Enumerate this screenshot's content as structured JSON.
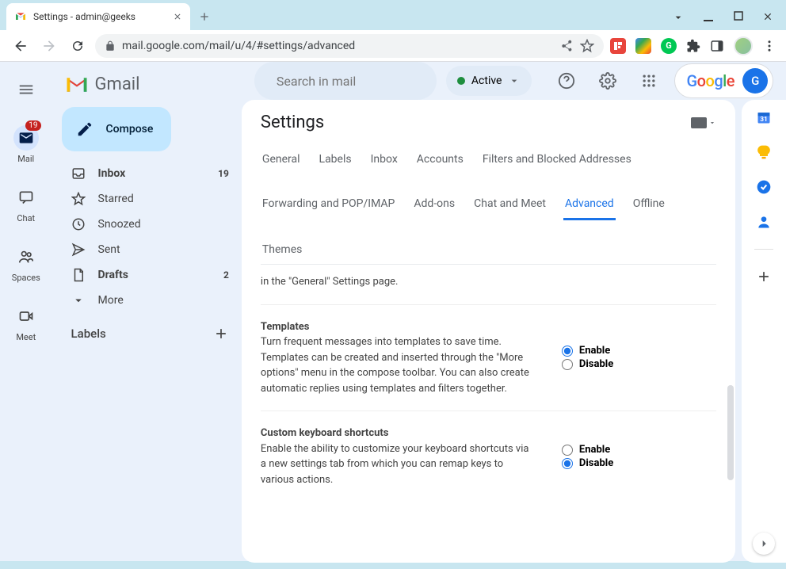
{
  "browser": {
    "tab_title": "Settings - admin@geeks",
    "url": "mail.google.com/mail/u/4/#settings/advanced"
  },
  "rail": {
    "mail_badge": "19",
    "items": [
      "Mail",
      "Chat",
      "Spaces",
      "Meet"
    ]
  },
  "sidebar": {
    "logo": "Gmail",
    "compose": "Compose",
    "folders": {
      "inbox": {
        "label": "Inbox",
        "count": "19"
      },
      "starred": {
        "label": "Starred"
      },
      "snoozed": {
        "label": "Snoozed"
      },
      "sent": {
        "label": "Sent"
      },
      "drafts": {
        "label": "Drafts",
        "count": "2"
      },
      "more": {
        "label": "More"
      }
    },
    "labels_header": "Labels"
  },
  "header": {
    "search_placeholder": "Search in mail",
    "status": "Active",
    "avatar_initial": "G"
  },
  "settings": {
    "title": "Settings",
    "tabs": [
      "General",
      "Labels",
      "Inbox",
      "Accounts",
      "Filters and Blocked Addresses",
      "Forwarding and POP/IMAP",
      "Add-ons",
      "Chat and Meet",
      "Advanced",
      "Offline",
      "Themes"
    ],
    "partial_row_text": "in the \"General\" Settings page.",
    "templates": {
      "title": "Templates",
      "desc": "Turn frequent messages into templates to save time. Templates can be created and inserted through the \"More options\" menu in the compose toolbar. You can also create automatic replies using templates and filters together.",
      "enable": "Enable",
      "disable": "Disable",
      "selected": "enable"
    },
    "shortcuts": {
      "title": "Custom keyboard shortcuts",
      "desc": "Enable the ability to customize your keyboard shortcuts via a new settings tab from which you can remap keys to various actions.",
      "enable": "Enable",
      "disable": "Disable",
      "selected": "disable"
    }
  }
}
